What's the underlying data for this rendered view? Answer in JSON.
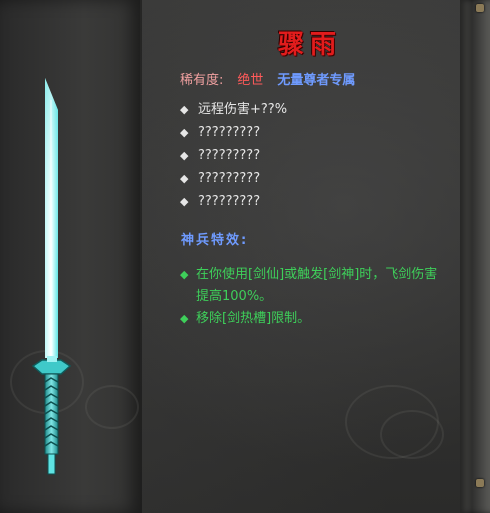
{
  "item": {
    "name": "骤雨",
    "rarity_label": "稀有度:",
    "rarity_value": "绝世",
    "exclusive_tag": "无量尊者专属"
  },
  "stats": [
    {
      "bullet_icon": "diamond-bullet",
      "text": "远程伤害+??%"
    },
    {
      "bullet_icon": "diamond-bullet",
      "text": "?????????"
    },
    {
      "bullet_icon": "diamond-bullet",
      "text": "?????????"
    },
    {
      "bullet_icon": "diamond-bullet",
      "text": "?????????"
    },
    {
      "bullet_icon": "diamond-bullet",
      "text": "?????????"
    }
  ],
  "special": {
    "title": "神兵特效:",
    "effects": [
      {
        "bullet_icon": "diamond-bullet",
        "text": "在你使用[剑仙]或触发[剑神]时，飞剑伤害提高100%。"
      },
      {
        "bullet_icon": "diamond-bullet",
        "text": "移除[剑热槽]限制。"
      }
    ]
  },
  "icons": {
    "sword": "cyan-sword-icon"
  },
  "colors": {
    "title": "#e21c1c",
    "rarity_label": "#f0a0a0",
    "rarity_value": "#ff5a5a",
    "exclusive": "#6f9bff",
    "stat_text": "#e6e6e6",
    "special_title": "#6f9bff",
    "effect_text": "#3ecf5a",
    "blade": "#5fe3e3"
  }
}
